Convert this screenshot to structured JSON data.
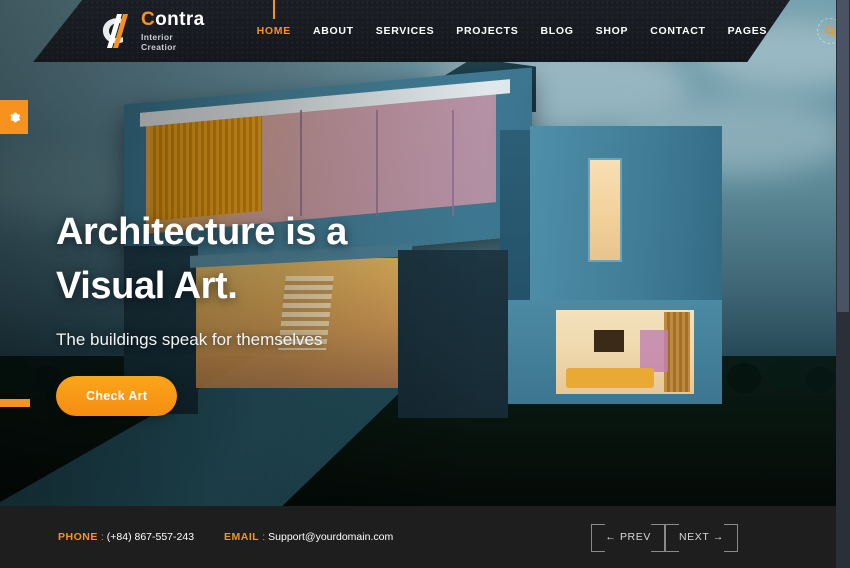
{
  "brand": {
    "name_part1": "C",
    "name_part2": "ontra",
    "tagline": "Interior Creatior",
    "logo_icon": "contra-monogram-icon"
  },
  "colors": {
    "accent_orange": "#f7921e",
    "header_dark": "#1b1f25",
    "footer_dark": "#1e1e1e",
    "building_blue": "#4d8ba4",
    "interior_gold": "#f4a81d"
  },
  "nav": {
    "items": [
      {
        "label": "HOME",
        "active": true
      },
      {
        "label": "ABOUT",
        "active": false
      },
      {
        "label": "SERVICES",
        "active": false
      },
      {
        "label": "PROJECTS",
        "active": false
      },
      {
        "label": "BLOG",
        "active": false
      },
      {
        "label": "SHOP",
        "active": false
      },
      {
        "label": "CONTACT",
        "active": false
      },
      {
        "label": "PAGES",
        "active": false
      }
    ],
    "search_icon": "search-icon"
  },
  "widgets": {
    "settings_icon": "gear-icon",
    "slider_indicator": "slide-position-indicator"
  },
  "hero": {
    "title_line1": "Architecture is a",
    "title_line2": "Visual Art.",
    "subtitle": "The buildings speak for themselves",
    "cta_label": "Check Art"
  },
  "footer": {
    "phone_label": "PHONE",
    "phone_sep": ":",
    "phone_value": "(+84) 867-557-243",
    "email_label": "EMAIL",
    "email_sep": ":",
    "email_value": "Support@yourdomain.com",
    "prev_label": "PREV",
    "next_label": "NEXT",
    "prev_arrow": "←",
    "next_arrow": "→"
  }
}
